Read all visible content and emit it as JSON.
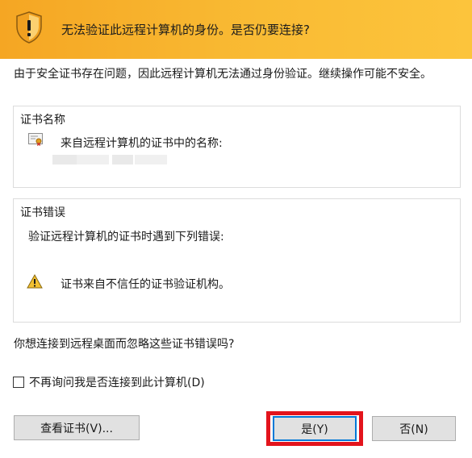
{
  "header": {
    "title": "无法验证此远程计算机的身份。是否仍要连接?"
  },
  "intro_text": "由于安全证书存在问题，因此远程计算机无法通过身份验证。继续操作可能不安全。",
  "certificate_name": {
    "group_title": "证书名称",
    "label": "来自远程计算机的证书中的名称:"
  },
  "certificate_errors": {
    "group_title": "证书错误",
    "label": "验证远程计算机的证书时遇到下列错误:",
    "items": [
      "证书来自不信任的证书验证机构。"
    ]
  },
  "question": "你想连接到远程桌面而忽略这些证书错误吗?",
  "dont_ask_checkbox": {
    "label": "不再询问我是否连接到此计算机(D)",
    "checked": false
  },
  "buttons": {
    "view_certificate": "查看证书(V)...",
    "yes": "是(Y)",
    "no": "否(N)"
  },
  "colors": {
    "header_bg": "#f9bb34",
    "highlight": "#e3141c",
    "focus": "#0078d7"
  },
  "icons": {
    "header": "shield-warning-icon",
    "certificate": "certificate-icon",
    "error": "warning-icon"
  }
}
